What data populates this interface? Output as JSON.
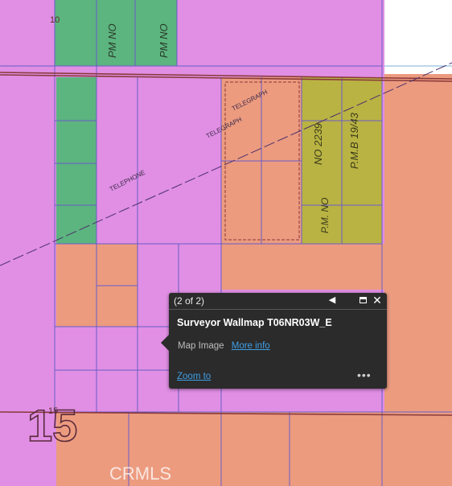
{
  "map": {
    "labels": {
      "section_10": "10",
      "section_15": "15",
      "telephone": "TELEPHONE",
      "telegraph": "TELEGRAPH",
      "telegraph2": "TELEGRAPH",
      "pm_no_a": "PM NO",
      "pm_no_b": "PM NO",
      "pm_no_2239": "NO 2239",
      "pmb": "P.M.B 19/43",
      "pm_no_c": "P.M. NO",
      "watermark": "CRMLS",
      "big_number": "15"
    },
    "colors": {
      "background": "#e08fe4",
      "green": "#5cb47f",
      "salmon": "#ec9b7f",
      "olive": "#b9b343",
      "parcel_line": "#6a5cc8",
      "road_line": "#8a3a3a"
    }
  },
  "popup": {
    "pager": "(2 of 2)",
    "prev_icon": "◀",
    "close_icon": "✕",
    "title": "Surveyor Wallmap T06NR03W_E",
    "attr_label": "Map Image",
    "attr_link": "More info",
    "zoom_label": "Zoom to",
    "more_label": "•••"
  }
}
